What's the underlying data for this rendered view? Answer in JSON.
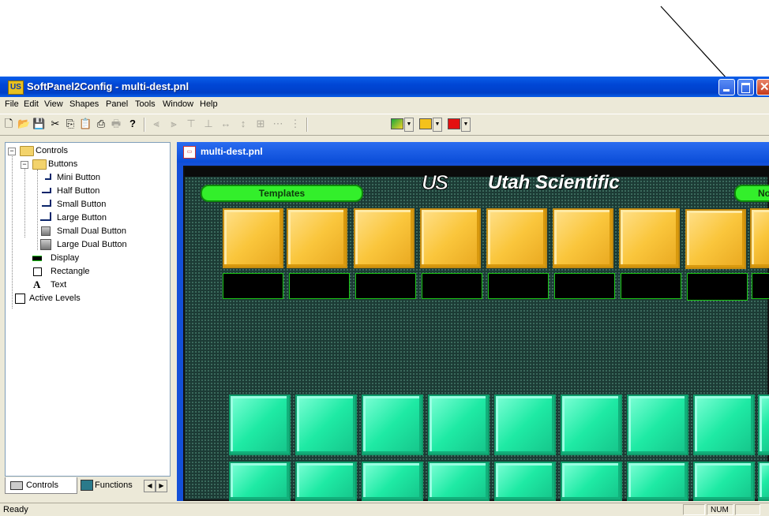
{
  "window": {
    "app_icon_text": "US",
    "title": "SoftPanel2Config - multi-dest.pnl"
  },
  "menu": [
    "File",
    "Edit",
    "View",
    "Shapes",
    "Panel",
    "Tools",
    "Window",
    "Help"
  ],
  "tree": {
    "controls": "Controls",
    "buttons": "Buttons",
    "mini_button": "Mini Button",
    "half_button": "Half Button",
    "small_button": "Small Button",
    "large_button": "Large Button",
    "small_dual_button": "Small Dual Button",
    "large_dual_button": "Large Dual Button",
    "display": "Display",
    "rectangle": "Rectangle",
    "text": "Text",
    "text_glyph": "A",
    "active_levels": "Active Levels"
  },
  "tabs": {
    "controls": "Controls",
    "functions": "Functions"
  },
  "document": {
    "title": "multi-dest.pnl",
    "logo_text": "Utah Scientific",
    "templates_label": "Templates",
    "right_pill_label": "No"
  },
  "status": {
    "ready": "Ready",
    "num": "NUM"
  },
  "colors": {
    "title_bar": "#0046d5",
    "panel_bg": "#1c3b35",
    "yellow_button": "#fac63c",
    "green_button": "#1eeaa4",
    "pill": "#33ef2b"
  }
}
